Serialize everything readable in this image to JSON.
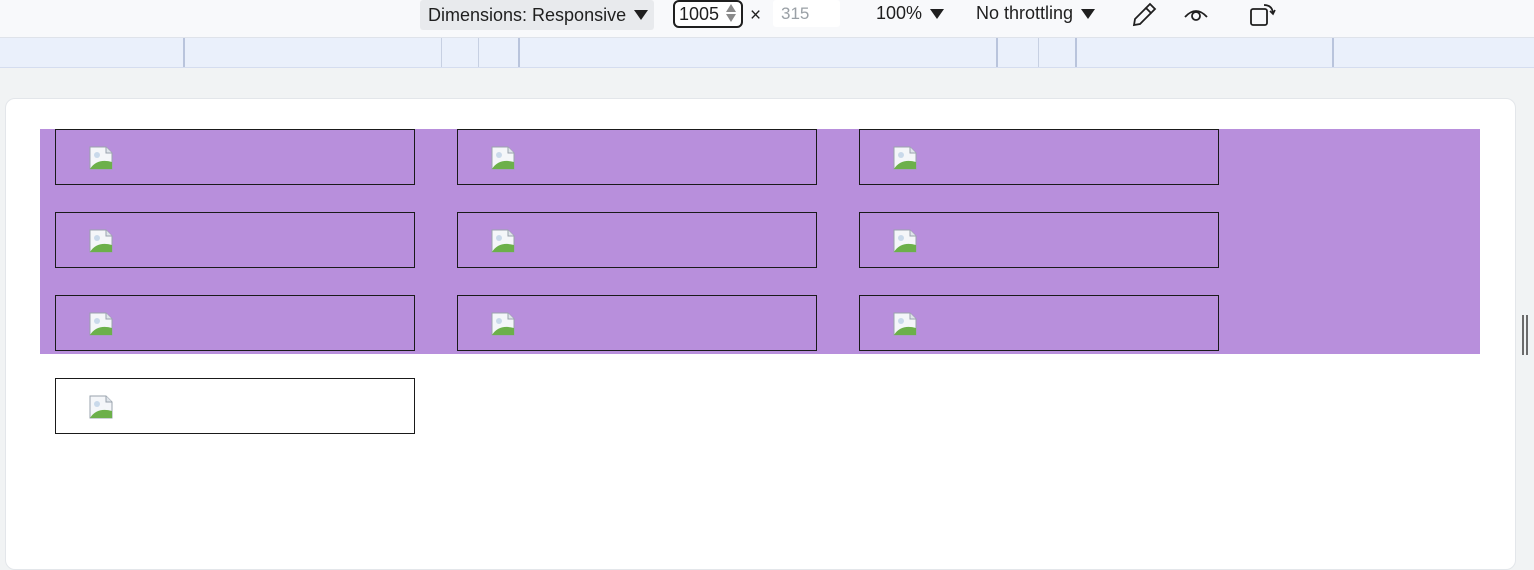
{
  "toolbar": {
    "dimensions_label": "Dimensions: Responsive",
    "width_value": "1005",
    "times_sign": "×",
    "height_placeholder": "315",
    "zoom_label": "100%",
    "throttle_label": "No throttling",
    "icons": [
      "eyedropper-icon",
      "eye-icon",
      "rotate-device-icon"
    ]
  },
  "viewport": {
    "grid_color": "#b88fdc",
    "cards": [
      {
        "image": "broken-image-icon"
      },
      {
        "image": "broken-image-icon"
      },
      {
        "image": "broken-image-icon"
      },
      {
        "image": "broken-image-icon"
      },
      {
        "image": "broken-image-icon"
      },
      {
        "image": "broken-image-icon"
      },
      {
        "image": "broken-image-icon"
      },
      {
        "image": "broken-image-icon"
      },
      {
        "image": "broken-image-icon"
      },
      {
        "image": "broken-image-icon"
      }
    ]
  }
}
